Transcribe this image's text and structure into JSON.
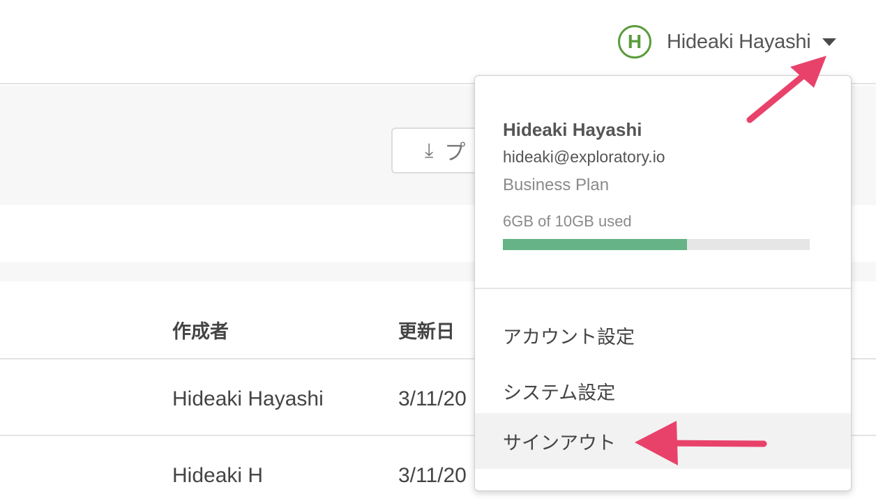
{
  "header": {
    "avatar_initial": "H",
    "user_name": "Hideaki Hayashi",
    "avatar_color": "#5a9c3c"
  },
  "toolbar": {
    "download_label": "プ"
  },
  "table": {
    "columns": [
      "作成者",
      "更新日"
    ],
    "rows": [
      {
        "author": "Hideaki Hayashi",
        "updated": "3/11/20"
      },
      {
        "author": "Hideaki H",
        "updated": "3/11/20"
      }
    ]
  },
  "dropdown": {
    "name": "Hideaki Hayashi",
    "email": "hideaki@exploratory.io",
    "plan": "Business Plan",
    "storage_text": "6GB of 10GB used",
    "storage_used_fraction": 0.6,
    "usage_color": "#66b387",
    "items": [
      {
        "label": "アカウント設定"
      },
      {
        "label": "システム設定"
      },
      {
        "label": "サインアウト",
        "highlighted": true
      }
    ]
  },
  "annotation_color": "#e8426b"
}
